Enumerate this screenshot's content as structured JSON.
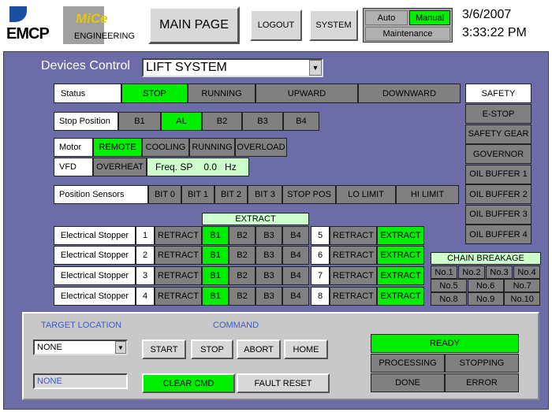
{
  "header": {
    "emcp_logo": "EMCP",
    "mice_logo": "MiCe",
    "engineering": "ENGINEERING",
    "main_page": "MAIN PAGE",
    "logout": "LOGOUT",
    "system": "SYSTEM",
    "auto": "Auto",
    "manual": "Manual",
    "maintenance": "Maintenance",
    "date": "3/6/2007",
    "time": "3:33:22 PM"
  },
  "devices": {
    "label": "Devices Control",
    "selected": "LIFT SYSTEM"
  },
  "status": {
    "label": "Status",
    "items": [
      "STOP",
      "RUNNING",
      "UPWARD",
      "DOWNWARD"
    ]
  },
  "stop_position": {
    "label": "Stop Position",
    "items": [
      "B1",
      "AL",
      "B2",
      "B3",
      "B4"
    ]
  },
  "motor": {
    "label": "Motor",
    "items": [
      "REMOTE",
      "COOLING",
      "RUNNING",
      "OVERLOAD"
    ]
  },
  "vfd": {
    "label": "VFD",
    "overheat": "OVERHEAT",
    "freq_label": "Freq. SP",
    "freq_value": "0.0",
    "freq_unit": "Hz"
  },
  "position_sensors": {
    "label": "Position Sensors",
    "items": [
      "BIT 0",
      "BIT 1",
      "BIT 2",
      "BIT 3",
      "STOP POS",
      "LO LIMIT",
      "HI LIMIT"
    ]
  },
  "extract_header": "EXTRACT",
  "stoppers": {
    "label": "Electrical Stopper",
    "retract": "RETRACT",
    "extract": "EXTRACT",
    "positions": [
      "B1",
      "B2",
      "B3",
      "B4"
    ],
    "left_numbers": [
      "1",
      "2",
      "3",
      "4"
    ],
    "right_numbers": [
      "5",
      "6",
      "7",
      "8"
    ]
  },
  "safety": {
    "title": "SAFETY",
    "items": [
      "E-STOP",
      "SAFETY GEAR",
      "GOVERNOR",
      "OIL BUFFER 1",
      "OIL BUFFER 2",
      "OIL BUFFER 3",
      "OIL BUFFER 4"
    ]
  },
  "chain_breakage": {
    "title": "CHAIN BREAKAGE",
    "items": [
      "No.1",
      "No.2",
      "No.3",
      "No.4",
      "No.5",
      "No.6",
      "No.7",
      "No.8",
      "No.9",
      "No.10"
    ]
  },
  "bottom": {
    "target_label": "TARGET LOCATION",
    "target_value": "NONE",
    "target_display": "NONE",
    "command_label": "COMMAND",
    "start": "START",
    "stop": "STOP",
    "abort": "ABORT",
    "home": "HOME",
    "clear_cmd": "CLEAR CMD",
    "fault_reset": "FAULT RESET",
    "ready": "READY",
    "processing": "PROCESSING",
    "stopping": "STOPPING",
    "done": "DONE",
    "error": "ERROR"
  },
  "colors": {
    "panel": "#6c6ca8",
    "active": "#00ee00",
    "inactive": "#808080"
  }
}
